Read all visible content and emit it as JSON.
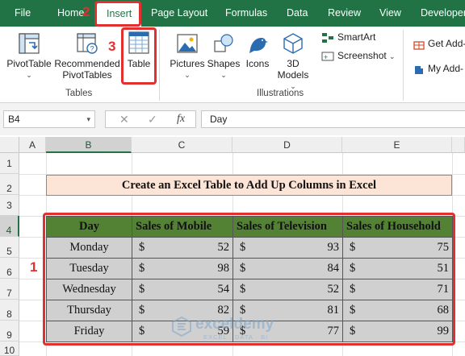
{
  "ribbon_tabs": {
    "file": "File",
    "home": "Home",
    "insert": "Insert",
    "page_layout": "Page Layout",
    "formulas": "Formulas",
    "data": "Data",
    "review": "Review",
    "view": "View",
    "developer": "Developer"
  },
  "ribbon": {
    "pivot_table": "PivotTable",
    "recommended_line1": "Recommended",
    "recommended_line2": "PivotTables",
    "table": "Table",
    "tables_group": "Tables",
    "pictures": "Pictures",
    "shapes": "Shapes",
    "icons": "Icons",
    "models_line1": "3D",
    "models_line2": "Models",
    "smartart": "SmartArt",
    "screenshot": "Screenshot",
    "illustrations_group": "Illustrations",
    "get_addins": "Get Add-",
    "my_addins": "My Add-"
  },
  "formula_bar": {
    "name_box": "B4",
    "cancel_symbol": "✕",
    "enter_symbol": "✓",
    "fx_label": "fx",
    "content": "Day"
  },
  "columns": [
    "A",
    "B",
    "C",
    "D",
    "E"
  ],
  "rows": [
    "1",
    "2",
    "3",
    "4",
    "5",
    "6",
    "7",
    "8",
    "9",
    "10"
  ],
  "sheet": {
    "title": "Create an Excel Table to Add Up Columns in Excel",
    "headers": [
      "Day",
      "Sales of Mobile",
      "Sales of Television",
      "Sales of Household"
    ],
    "currency": "$",
    "records": [
      {
        "day": "Monday",
        "mobile": "52",
        "tv": "93",
        "household": "75"
      },
      {
        "day": "Tuesday",
        "mobile": "98",
        "tv": "84",
        "household": "51"
      },
      {
        "day": "Wednesday",
        "mobile": "54",
        "tv": "52",
        "household": "71"
      },
      {
        "day": "Thursday",
        "mobile": "82",
        "tv": "81",
        "household": "68"
      },
      {
        "day": "Friday",
        "mobile": "59",
        "tv": "77",
        "household": "99"
      }
    ]
  },
  "annotations": {
    "step1": "1",
    "step2": "2",
    "step3": "3"
  },
  "watermark": {
    "name": "exceldemy",
    "tagline": "EXCEL · DATA · BI"
  },
  "colors": {
    "excel_green": "#217346",
    "header_green": "#548235",
    "title_fill": "#fce4d6",
    "cell_fill": "#d0d0d0",
    "annotation_red": "#e03030"
  }
}
